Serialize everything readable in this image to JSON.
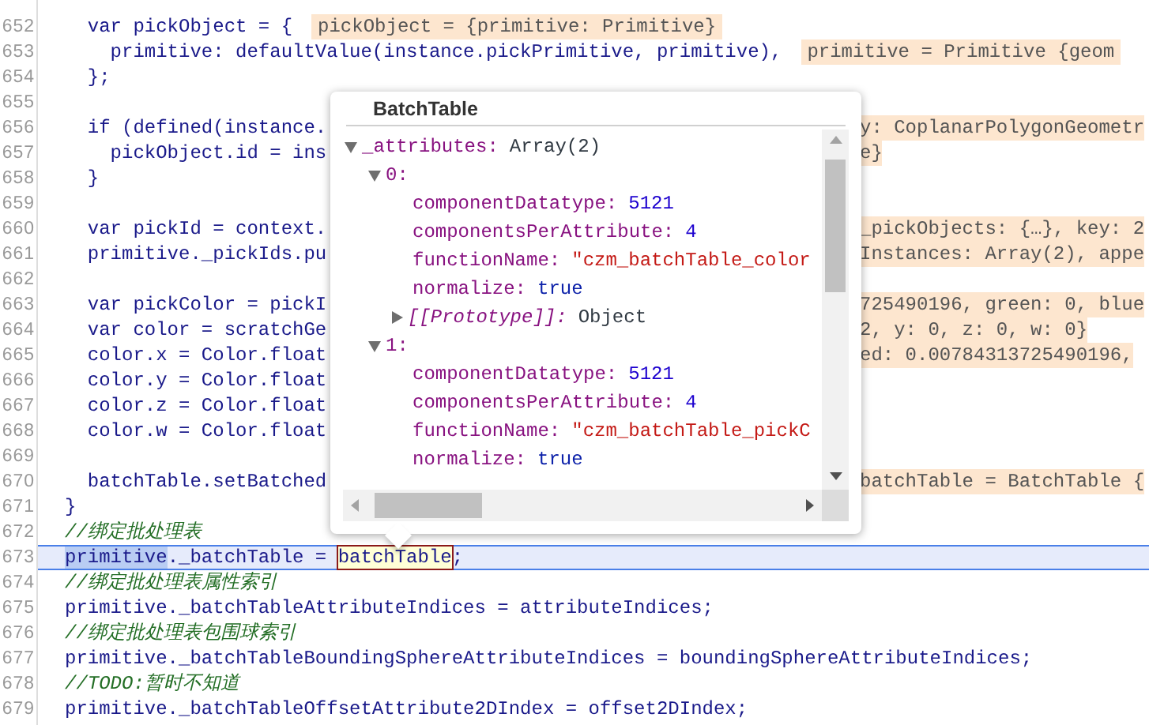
{
  "editor": {
    "lines": [
      {
        "number": "652",
        "kind": "code",
        "code": "  var pickObject = {",
        "current": false,
        "value": {
          "text": "pickObject = {primitive: Primitive}",
          "kind": "inline"
        }
      },
      {
        "number": "653",
        "kind": "code",
        "code": "    primitive: defaultValue(instance.pickPrimitive, primitive),",
        "current": false,
        "value": {
          "text": "primitive = Primitive {geom",
          "kind": "inline"
        }
      },
      {
        "number": "654",
        "kind": "code",
        "code": "  };",
        "current": false
      },
      {
        "number": "655",
        "kind": "code",
        "current": false
      },
      {
        "number": "656",
        "kind": "code",
        "code": "  if (defined(instance.",
        "current": false,
        "value": {
          "text": "y: CoplanarPolygonGeometr",
          "kind": "beside"
        }
      },
      {
        "number": "657",
        "kind": "code",
        "code": "    pickObject.id = ins",
        "current": false,
        "value": {
          "text": "e}",
          "kind": "beside"
        }
      },
      {
        "number": "658",
        "kind": "code",
        "code": "  }",
        "current": false
      },
      {
        "number": "659",
        "kind": "code",
        "current": false
      },
      {
        "number": "660",
        "kind": "code",
        "code": "  var pickId = context.",
        "current": false,
        "value": {
          "text": "_pickObjects: {…}, key: 2",
          "kind": "beside"
        }
      },
      {
        "number": "661",
        "kind": "code",
        "code": "  primitive._pickIds.pu",
        "current": false,
        "value": {
          "text": "Instances: Array(2), appe",
          "kind": "beside"
        }
      },
      {
        "number": "662",
        "kind": "code",
        "current": false
      },
      {
        "number": "663",
        "kind": "code",
        "code": "  var pickColor = pickI",
        "current": false,
        "value": {
          "text": "725490196, green: 0, blue",
          "kind": "beside"
        }
      },
      {
        "number": "664",
        "kind": "code",
        "code": "  var color = scratchGe",
        "current": false,
        "value": {
          "text": "2, y: 0, z: 0, w: 0}",
          "kind": "beside"
        }
      },
      {
        "number": "665",
        "kind": "code",
        "code": "  color.x = Color.float",
        "current": false,
        "value": {
          "text": "ed: 0.00784313725490196,",
          "kind": "beside"
        }
      },
      {
        "number": "666",
        "kind": "code",
        "code": "  color.y = Color.float",
        "current": false
      },
      {
        "number": "667",
        "kind": "code",
        "code": "  color.z = Color.float",
        "current": false
      },
      {
        "number": "668",
        "kind": "code",
        "code": "  color.w = Color.float",
        "current": false
      },
      {
        "number": "669",
        "kind": "code",
        "current": false
      },
      {
        "number": "670",
        "kind": "code",
        "code": "  batchTable.setBatched",
        "current": false,
        "value": {
          "text": "batchTable = BatchTable {",
          "kind": "beside"
        }
      },
      {
        "number": "671",
        "kind": "code",
        "code": "}",
        "current": false
      },
      {
        "number": "672",
        "kind": "comment",
        "code": "//绑定批处理表",
        "current": false
      },
      {
        "number": "673",
        "current": true,
        "segments": [
          {
            "text": "primitive",
            "kind": "selected"
          },
          {
            "text": "._batchTable = ",
            "kind": "plain"
          },
          {
            "text": "batchTable",
            "kind": "hovered"
          },
          {
            "text": ";",
            "kind": "plain"
          }
        ]
      },
      {
        "number": "674",
        "kind": "comment",
        "code": "//绑定批处理表属性索引",
        "current": false
      },
      {
        "number": "675",
        "kind": "code",
        "code": "primitive._batchTableAttributeIndices = attributeIndices;",
        "current": false
      },
      {
        "number": "676",
        "kind": "comment",
        "code": "//绑定批处理表包围球索引",
        "current": false
      },
      {
        "number": "677",
        "kind": "code",
        "code": "primitive._batchTableBoundingSphereAttributeIndices = boundingSphereAttributeIndices;",
        "current": false
      },
      {
        "number": "678",
        "kind": "comment",
        "code": "//TODO:暂时不知道",
        "current": false
      },
      {
        "number": "679",
        "kind": "code",
        "code": "primitive._batchTableOffsetAttribute2DIndex = offset2DIndex;",
        "current": false
      }
    ]
  },
  "tooltip": {
    "title": "BatchTable",
    "tree": [
      {
        "key": "_attributes:",
        "value": "Array(2)",
        "kind": "object",
        "expanded": true,
        "children": [
          {
            "key": "0:",
            "expanded": true,
            "children": [
              {
                "key": "componentDatatype:",
                "value": "5121",
                "kind": "number"
              },
              {
                "key": "componentsPerAttribute:",
                "value": "4",
                "kind": "number"
              },
              {
                "key": "functionName:",
                "value": "\"czm_batchTable_color",
                "kind": "string"
              },
              {
                "key": "normalize:",
                "value": "true",
                "kind": "boolean"
              },
              {
                "key": "[[Prototype]]:",
                "value": "Object",
                "kind": "object",
                "expanded": false,
                "internal": true
              }
            ]
          },
          {
            "key": "1:",
            "expanded": true,
            "children": [
              {
                "key": "componentDatatype:",
                "value": "5121",
                "kind": "number"
              },
              {
                "key": "componentsPerAttribute:",
                "value": "4",
                "kind": "number"
              },
              {
                "key": "functionName:",
                "value": "\"czm_batchTable_pickC",
                "kind": "string"
              },
              {
                "key": "normalize:",
                "value": "true",
                "kind": "boolean"
              }
            ]
          }
        ]
      }
    ]
  }
}
